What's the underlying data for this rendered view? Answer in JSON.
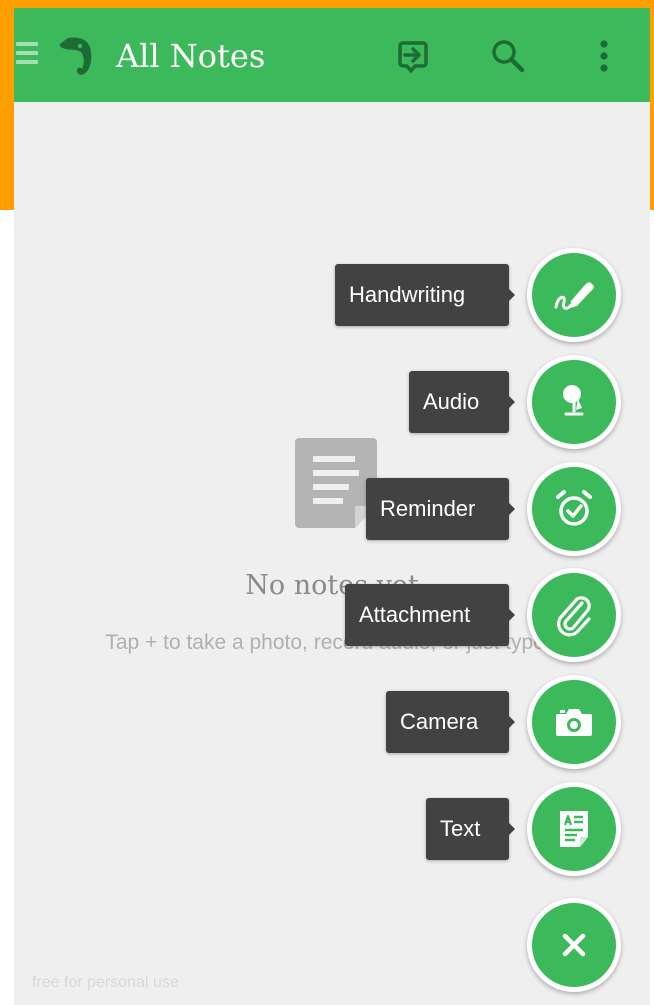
{
  "colors": {
    "accent": "#3cb95a",
    "label_bg": "#424242",
    "frame": "#ff9f00",
    "screen_bg": "#efefef"
  },
  "header": {
    "title": "All Notes",
    "menu_icon": "hamburger-icon",
    "logo_icon": "elephant-logo-icon",
    "actions": [
      "sync-icon",
      "search-icon",
      "overflow-menu-icon"
    ]
  },
  "empty_state": {
    "icon": "note-document-icon",
    "title": "No notes yet",
    "hint": "Tap + to take a photo, record audio, or just type."
  },
  "fab_menu": {
    "items": [
      {
        "label": "Handwriting",
        "icon": "handwriting-pen-icon"
      },
      {
        "label": "Audio",
        "icon": "microphone-icon"
      },
      {
        "label": "Reminder",
        "icon": "alarm-clock-icon"
      },
      {
        "label": "Attachment",
        "icon": "paperclip-icon"
      },
      {
        "label": "Camera",
        "icon": "camera-icon"
      },
      {
        "label": "Text",
        "icon": "text-note-icon"
      }
    ],
    "close_icon": "close-icon"
  },
  "watermark": "free for personal use"
}
